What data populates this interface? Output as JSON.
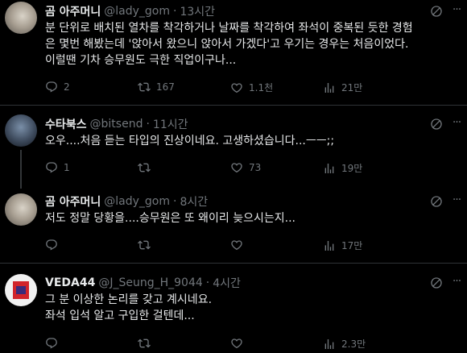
{
  "tweets": [
    {
      "name": "곰 아주머니",
      "handle": "@lady_gom",
      "time": "13시간",
      "text": "분 단위로 배치된 열차를 착각하거나 날짜를 착각하여 좌석이 중복된 듯한 경험\n은 몇번 해봤는데 '앉아서 왔으니 앉아서 가겠다'고 우기는 경우는 처음이었다.\n이럴땐 기차 승무원도 극한 직업이구나...",
      "replies": "2",
      "retweets": "167",
      "likes": "1.1천",
      "views": "21만"
    },
    {
      "name": "수타북스",
      "handle": "@bitsend",
      "time": "11시간",
      "text": "오우....처음 듣는 타입의 진상이네요. 고생하셨습니다...ㅡㅡ;;",
      "replies": "1",
      "retweets": "",
      "likes": "73",
      "views": "19만"
    },
    {
      "name": "곰 아주머니",
      "handle": "@lady_gom",
      "time": "8시간",
      "text": "저도 정말 당황을....승무원은 또 왜이리 늦으시는지...",
      "replies": "",
      "retweets": "",
      "likes": "",
      "views": "17만"
    },
    {
      "name": "VEDA44",
      "handle": "@J_Seung_H_9044",
      "time": "4시간",
      "text": "그 분 이상한 논리를 갖고 계시네요.\n좌석 입석 알고 구입한 걸텐데...",
      "replies": "",
      "retweets": "",
      "likes": "",
      "views": "2.3만"
    }
  ],
  "separator": "·",
  "colors": {
    "background": "#000000",
    "text": "#e7e9ea",
    "muted": "#71767b",
    "divider": "#2f3336"
  },
  "icons": [
    "reply-icon",
    "retweet-icon",
    "like-icon",
    "views-icon",
    "grok-icon",
    "more-icon"
  ]
}
